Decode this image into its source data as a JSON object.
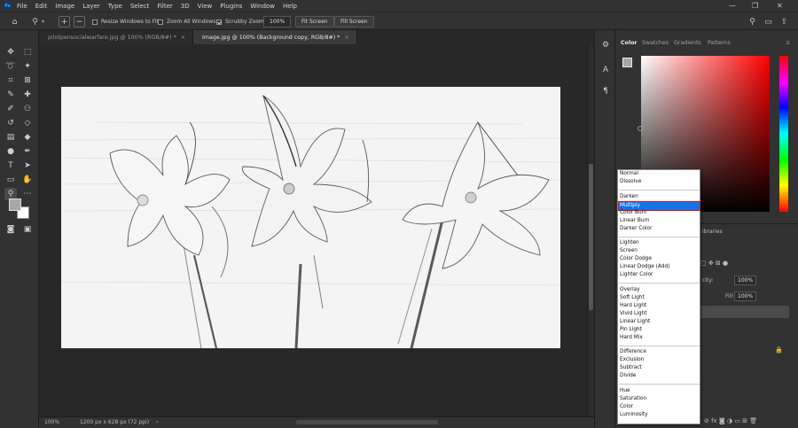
{
  "menu": [
    "File",
    "Edit",
    "Image",
    "Layer",
    "Type",
    "Select",
    "Filter",
    "3D",
    "View",
    "Plugins",
    "Window",
    "Help"
  ],
  "app_logo": "Ps",
  "window_controls": {
    "minimize": "—",
    "restore": "❐",
    "close": "✕"
  },
  "options_bar": {
    "resize_windows": "Resize Windows to Fit",
    "zoom_all": "Zoom All Windows",
    "scrubby_zoom": "Scrubby Zoom",
    "zoom_value": "100%",
    "fit_screen": "Fit Screen",
    "fill_screen": "Fill Screen",
    "resize_checked": false,
    "zoom_all_checked": false,
    "scrubby_checked": true
  },
  "tabs": [
    {
      "title": "pilotpensocialwarfare.jpg @ 100% (RGB/8#) *",
      "active": false
    },
    {
      "title": "Image.jpg @ 100% (Background copy, RGB/8#) *",
      "active": true
    }
  ],
  "status": {
    "zoom": "100%",
    "doc_size": "1200 px x 628 px (72 ppi)",
    "arrow": "›"
  },
  "panel_tabs": [
    "Color",
    "Swatches",
    "Gradients",
    "Patterns"
  ],
  "lower_panel": {
    "libraries_label": "ibraries",
    "opacity_label": "city:",
    "opacity_value": "100%",
    "fill_label": "Fill:",
    "fill_value": "100%"
  },
  "blend_groups": [
    [
      "Normal",
      "Dissolve"
    ],
    [
      "Darken",
      "Multiply",
      "Color Burn",
      "Linear Burn",
      "Darker Color"
    ],
    [
      "Lighten",
      "Screen",
      "Color Dodge",
      "Linear Dodge (Add)",
      "Lighter Color"
    ],
    [
      "Overlay",
      "Soft Light",
      "Hard Light",
      "Vivid Light",
      "Linear Light",
      "Pin Light",
      "Hard Mix"
    ],
    [
      "Difference",
      "Exclusion",
      "Subtract",
      "Divide"
    ],
    [
      "Hue",
      "Saturation",
      "Color",
      "Luminosity"
    ]
  ],
  "blend_selected": "Multiply",
  "colors": {
    "ui_bg": "#323232",
    "canvas_bg": "#282828",
    "selection": "#1473e6",
    "highlight_outline": "#e81123",
    "foreground_swatch": "#a7a7a7",
    "background_swatch": "#ffffff"
  }
}
